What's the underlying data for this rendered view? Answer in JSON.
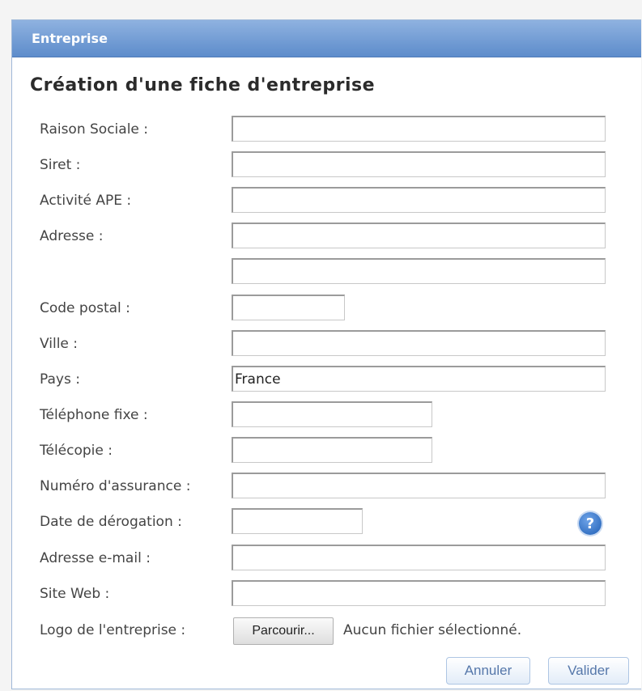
{
  "window": {
    "title": "Entreprise"
  },
  "form": {
    "title": "Création d'une fiche d'entreprise",
    "fields": {
      "raison_sociale": {
        "label": "Raison Sociale :",
        "value": ""
      },
      "siret": {
        "label": "Siret :",
        "value": ""
      },
      "activite_ape": {
        "label": "Activité APE :",
        "value": ""
      },
      "adresse": {
        "label": "Adresse :",
        "value": "",
        "value2": ""
      },
      "code_postal": {
        "label": "Code postal :",
        "value": ""
      },
      "ville": {
        "label": "Ville :",
        "value": ""
      },
      "pays": {
        "label": "Pays :",
        "value": "France"
      },
      "telephone_fixe": {
        "label": "Téléphone fixe :",
        "value": ""
      },
      "telecopie": {
        "label": "Télécopie :",
        "value": ""
      },
      "numero_assurance": {
        "label": "Numéro d'assurance :",
        "value": ""
      },
      "date_derogation": {
        "label": "Date de dérogation :",
        "value": ""
      },
      "adresse_email": {
        "label": "Adresse e-mail :",
        "value": ""
      },
      "site_web": {
        "label": "Site Web :",
        "value": ""
      },
      "logo": {
        "label": "Logo de l'entreprise :",
        "browse_label": "Parcourir...",
        "file_status": "Aucun fichier sélectionné."
      }
    },
    "help_icon_glyph": "?",
    "help_icon": "question-mark-icon",
    "buttons": {
      "cancel": "Annuler",
      "submit": "Valider"
    }
  },
  "colors": {
    "titlebar": "#5d8ccb",
    "button_text": "#5577aa",
    "help_icon": "#1f5fb5"
  }
}
